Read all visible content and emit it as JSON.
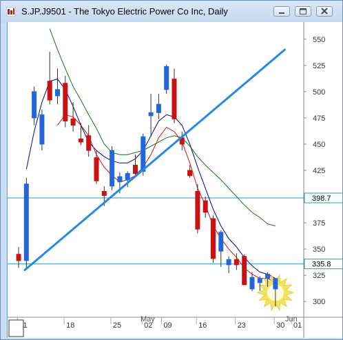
{
  "window": {
    "title": "S.JP.J9501 - The Tokyo Electric Power Co Inc, Daily",
    "app_icon": "chart-app-icon",
    "controls": {
      "minimize_icon": "minimize-icon",
      "maximize_icon": "maximize-icon",
      "close_icon": "close-icon"
    }
  },
  "colors": {
    "up_candle": "#2266dd",
    "down_candle": "#cc1111",
    "ma_fast": "#dd1111",
    "ma_mid": "#000099",
    "ma_slow": "#117711",
    "trendline": "#2288ee",
    "level_line": "#2299cc",
    "highlight": "#f3e24a"
  },
  "chart_data": {
    "type": "candlestick",
    "symbol": "S.JP.J9501",
    "interval": "Daily",
    "ylim": [
      285,
      565
    ],
    "y_ticks": [
      300,
      325,
      350,
      375,
      400,
      425,
      450,
      475,
      500,
      525,
      550
    ],
    "x_tick_labels": [
      "11",
      "18",
      "25",
      "02",
      "09",
      "16",
      "23",
      "30",
      "01"
    ],
    "month_labels": [
      "May",
      "Jun"
    ],
    "levels": [
      {
        "value": 398.7,
        "label": "398.7"
      },
      {
        "value": 335.8,
        "label": "335.8"
      }
    ],
    "candles": [
      {
        "o": 345,
        "h": 352,
        "l": 332,
        "c": 339
      },
      {
        "o": 339,
        "h": 418,
        "l": 332,
        "c": 412
      },
      {
        "o": 475,
        "h": 505,
        "l": 468,
        "c": 500
      },
      {
        "o": 450,
        "h": 483,
        "l": 444,
        "c": 478
      },
      {
        "o": 510,
        "h": 538,
        "l": 488,
        "c": 492
      },
      {
        "o": 496,
        "h": 522,
        "l": 488,
        "c": 502
      },
      {
        "o": 508,
        "h": 515,
        "l": 466,
        "c": 472
      },
      {
        "o": 474,
        "h": 490,
        "l": 462,
        "c": 468
      },
      {
        "o": 455,
        "h": 470,
        "l": 449,
        "c": 452
      },
      {
        "o": 458,
        "h": 468,
        "l": 438,
        "c": 444
      },
      {
        "o": 437,
        "h": 444,
        "l": 412,
        "c": 415
      },
      {
        "o": 405,
        "h": 410,
        "l": 391,
        "c": 401
      },
      {
        "o": 410,
        "h": 448,
        "l": 406,
        "c": 444
      },
      {
        "o": 414,
        "h": 423,
        "l": 403,
        "c": 419
      },
      {
        "o": 416,
        "h": 424,
        "l": 409,
        "c": 422
      },
      {
        "o": 430,
        "h": 440,
        "l": 420,
        "c": 422
      },
      {
        "o": 424,
        "h": 460,
        "l": 420,
        "c": 457
      },
      {
        "o": 477,
        "h": 498,
        "l": 457,
        "c": 480
      },
      {
        "o": 480,
        "h": 498,
        "l": 474,
        "c": 488
      },
      {
        "o": 502,
        "h": 526,
        "l": 498,
        "c": 524
      },
      {
        "o": 512,
        "h": 522,
        "l": 470,
        "c": 474
      },
      {
        "o": 456,
        "h": 462,
        "l": 444,
        "c": 450
      },
      {
        "o": 425,
        "h": 430,
        "l": 418,
        "c": 420
      },
      {
        "o": 405,
        "h": 412,
        "l": 365,
        "c": 369
      },
      {
        "o": 396,
        "h": 400,
        "l": 380,
        "c": 385
      },
      {
        "o": 379,
        "h": 382,
        "l": 337,
        "c": 341
      },
      {
        "o": 348,
        "h": 368,
        "l": 333,
        "c": 366
      },
      {
        "o": 335,
        "h": 343,
        "l": 327,
        "c": 340
      },
      {
        "o": 340,
        "h": 346,
        "l": 330,
        "c": 335
      },
      {
        "o": 343,
        "h": 345,
        "l": 316,
        "c": 316
      },
      {
        "o": 312,
        "h": 328,
        "l": 310,
        "c": 323
      },
      {
        "o": 318,
        "h": 324,
        "l": 310,
        "c": 322
      },
      {
        "o": 322,
        "h": 328,
        "l": 314,
        "c": 326
      },
      {
        "o": 312,
        "h": 322,
        "l": 295,
        "c": 322
      }
    ],
    "ma_fast": [
      null,
      null,
      null,
      null,
      null,
      468,
      478,
      476,
      468,
      458,
      440,
      428,
      420,
      414,
      416,
      420,
      428,
      440,
      456,
      466,
      462,
      452,
      432,
      408,
      392,
      372,
      360,
      350,
      342,
      332,
      326,
      322,
      322,
      318
    ],
    "ma_mid": [
      null,
      426,
      462,
      490,
      510,
      512,
      502,
      486,
      468,
      452,
      444,
      438,
      434,
      432,
      432,
      436,
      444,
      458,
      472,
      478,
      476,
      468,
      450,
      428,
      408,
      388,
      372,
      360,
      352,
      342,
      334,
      328,
      326,
      322
    ],
    "ma_slow": [
      null,
      null,
      null,
      null,
      560,
      540,
      522,
      505,
      492,
      478,
      465,
      450,
      442,
      440,
      440,
      442,
      444,
      448,
      452,
      456,
      458,
      456,
      448,
      438,
      430,
      423,
      416,
      408,
      400,
      392,
      385,
      380,
      374,
      372
    ],
    "trendline": {
      "from": {
        "index": 0.8,
        "value": 330
      },
      "to": {
        "index": 34.2,
        "value": 540
      }
    },
    "highlight_candle_index": 33
  }
}
